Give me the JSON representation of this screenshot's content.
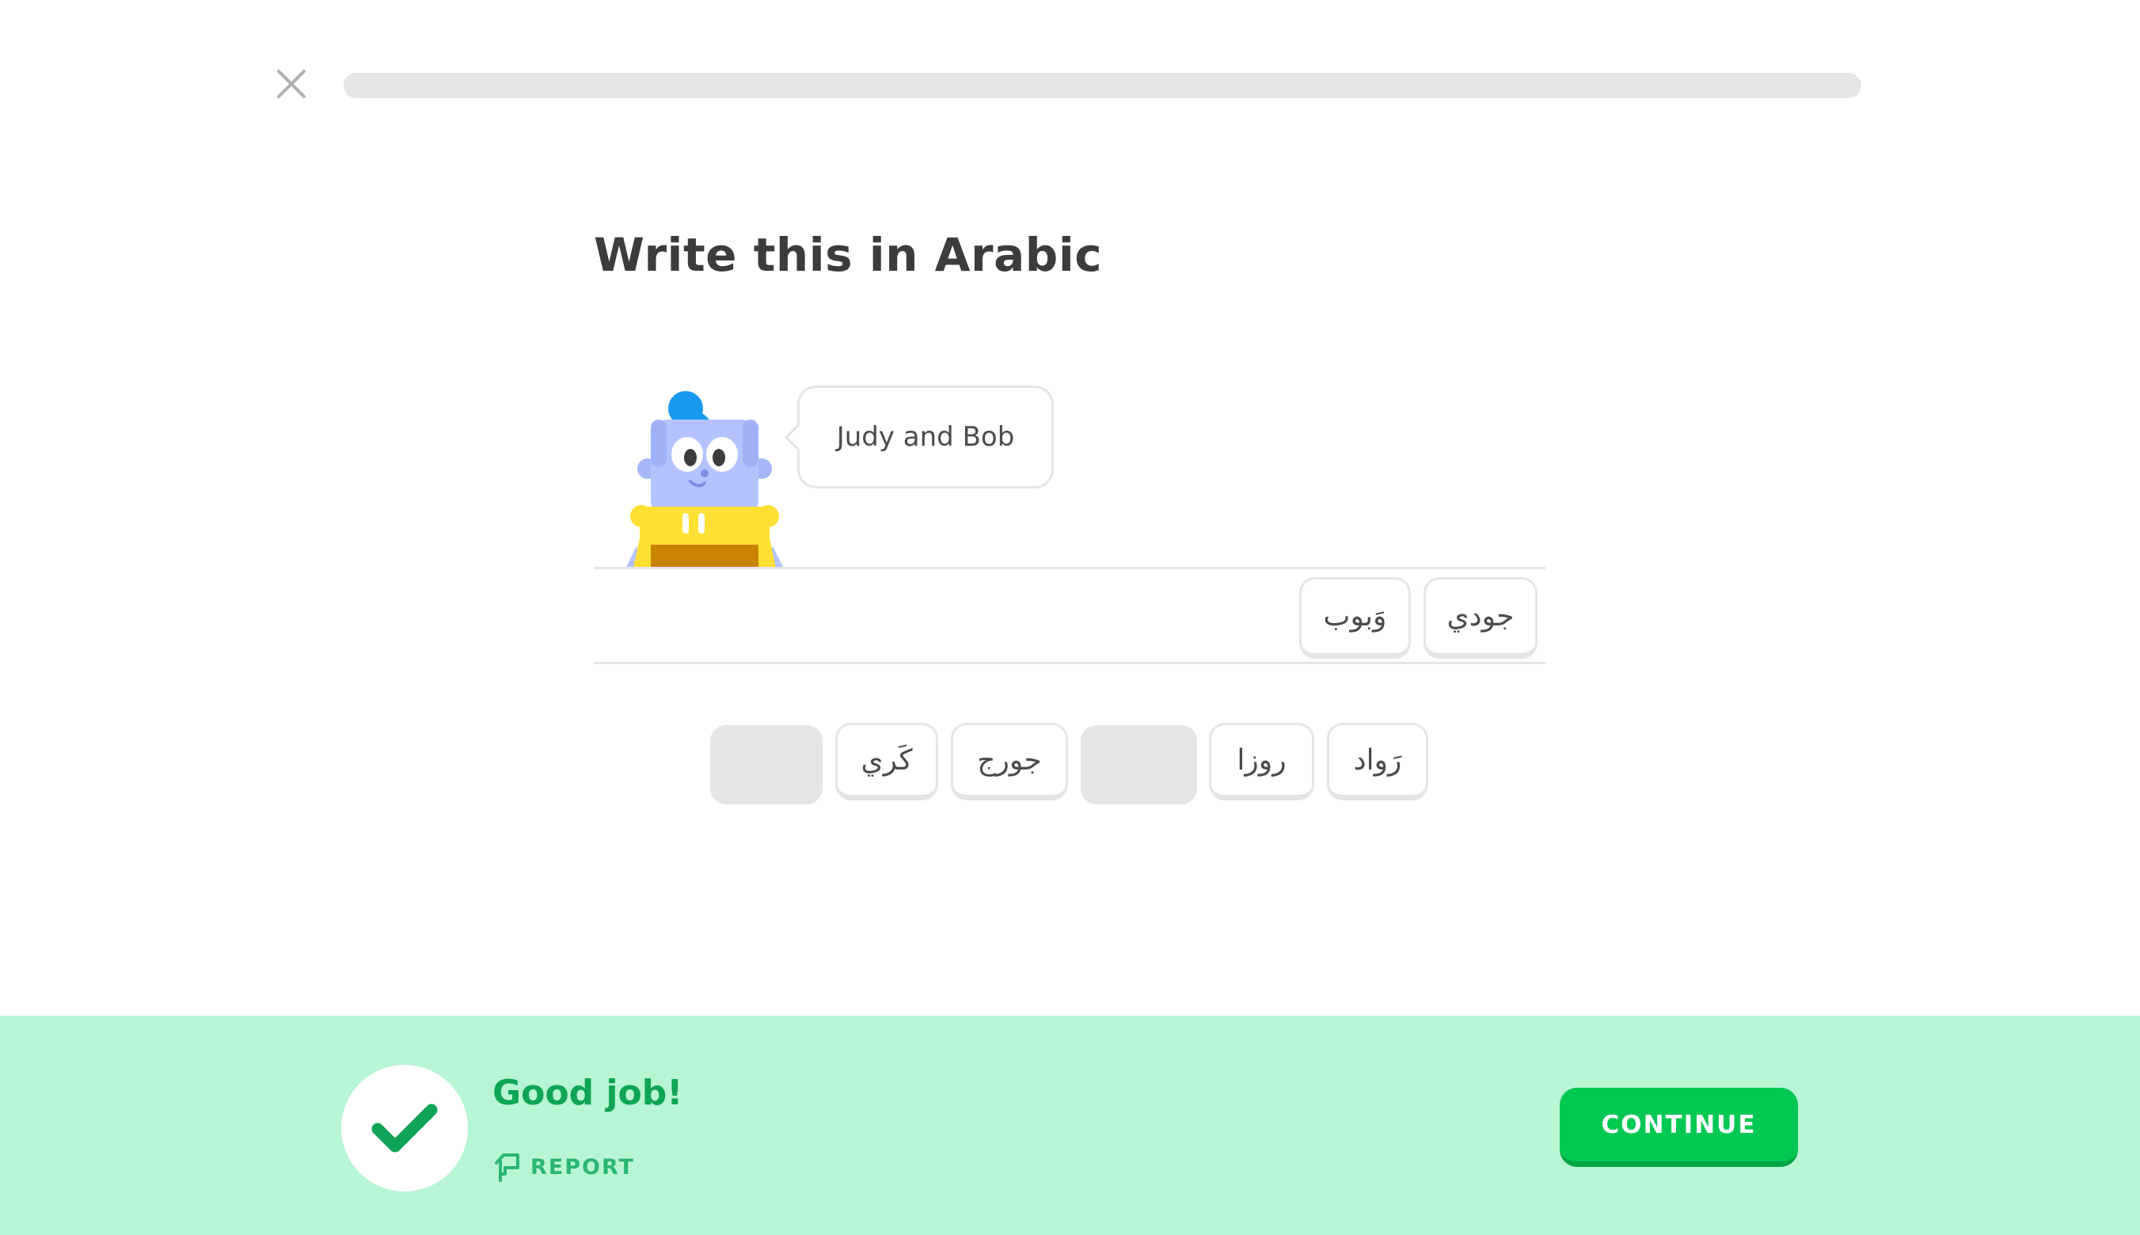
{
  "header": {
    "close_icon": "close-icon",
    "progress_fraction": 0.0
  },
  "prompt": {
    "title": "Write this in Arabic",
    "bubble_text": "Judy and Bob"
  },
  "answer": {
    "selected_tiles": [
      "جودي",
      "وَبوب"
    ]
  },
  "word_bank": {
    "tiles": [
      "رَواد",
      "روزا",
      "",
      "جورج",
      "كَري",
      ""
    ]
  },
  "feedback": {
    "status": "correct",
    "message": "Good job!",
    "report_label": "REPORT",
    "report_icon": "flag-icon",
    "check_icon": "checkmark-icon",
    "continue_label": "CONTINUE"
  },
  "colors": {
    "feedback_bg": "#b8f5d4",
    "success_text": "#0fa456",
    "continue_bg": "#00c853",
    "tile_border": "#e5e5e5"
  }
}
